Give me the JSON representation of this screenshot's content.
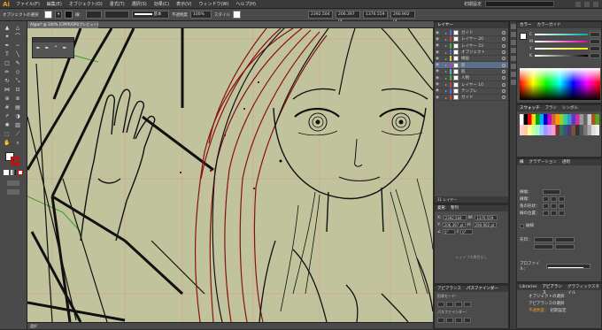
{
  "menubar": {
    "logo": "Ai",
    "items": [
      "ファイル(F)",
      "編集(E)",
      "オブジェクト(O)",
      "書式(T)",
      "選択(S)",
      "効果(C)",
      "表示(V)",
      "ウィンドウ(W)",
      "ヘルプ(H)"
    ],
    "workspace": "初期設定"
  },
  "control": {
    "selection": "オブジェクトの選択",
    "stroke_label": "線：",
    "stroke_style": "基本",
    "opacity_label": "不透明度",
    "opacity": "100%",
    "style_label": "スタイル",
    "x_value": "2392.504",
    "y_value": "206.397 pt",
    "w_value": "1376.559",
    "h_value": "290.902 pt"
  },
  "doc": {
    "tab": "AI@ai* @ 300% (CMYK/GPUプレビュー)",
    "status": "選択"
  },
  "colors": {
    "accent": "#f39a1e",
    "selected": "#5d6e8a",
    "line_red": "#8a1010",
    "green": "#3c9b2c",
    "artboard": "#c1c39d"
  },
  "layers": {
    "tab": "レイヤー",
    "items": [
      {
        "name": "ガイド",
        "color": "#4f6bd6"
      },
      {
        "name": "レイヤー 20",
        "color": "#d13d3d"
      },
      {
        "name": "レイヤー 23",
        "color": "#3cb04a"
      },
      {
        "name": "オブジェクト",
        "color": "#4f6bd6"
      },
      {
        "name": "線画",
        "color": "#e0c43a"
      },
      {
        "name": "影",
        "color": "#c53bb8"
      },
      {
        "name": "肌",
        "color": "#49b6c9"
      },
      {
        "name": "人物",
        "color": "#3cb04a"
      },
      {
        "name": "レイヤー 10",
        "color": "#d13d3d"
      },
      {
        "name": "テンプレ",
        "color": "#4f6bd6"
      },
      {
        "name": "ガイド",
        "color": "#d13d3d"
      }
    ],
    "footer": "11 レイヤー"
  },
  "transform": {
    "tabs": [
      "変形",
      "整列"
    ],
    "x": "2392.504",
    "y": "206.397 pt",
    "w": "1376.559",
    "h": "290.902 pt",
    "angle": "0°",
    "shear": "0°",
    "note": "シェイプの属性なし"
  },
  "appearance": {
    "tabs": [
      "アピアランス",
      "パスファインダー"
    ],
    "shape_mode": "形状モード：",
    "pathfinder": "パスファインダー："
  },
  "color_panel": {
    "tab": "カラー",
    "guide_tab": "カラーガイド",
    "cmyk": [
      "C",
      "M",
      "Y",
      "K"
    ]
  },
  "swatches": {
    "tabs": [
      "スウォッチ",
      "ブラシ",
      "シンボル"
    ]
  },
  "stroke_panel": {
    "tabs": [
      "線",
      "グラデーション",
      "透明"
    ],
    "weight_label": "線幅：",
    "cap_label": "線端：",
    "corner_label": "角の形状：",
    "align_label": "線の位置：",
    "dash_label": "破線",
    "arrow_label": "矢印：",
    "profile_label": "プロファイル："
  },
  "libraries": {
    "tabs": [
      "Libraries",
      "アピアランス",
      "グラフィックスタイル"
    ],
    "object": "オブジェクトの選択",
    "stroke_item": "アピアランスの選択",
    "fill_item": "不透明度：",
    "default": "初期設定"
  }
}
